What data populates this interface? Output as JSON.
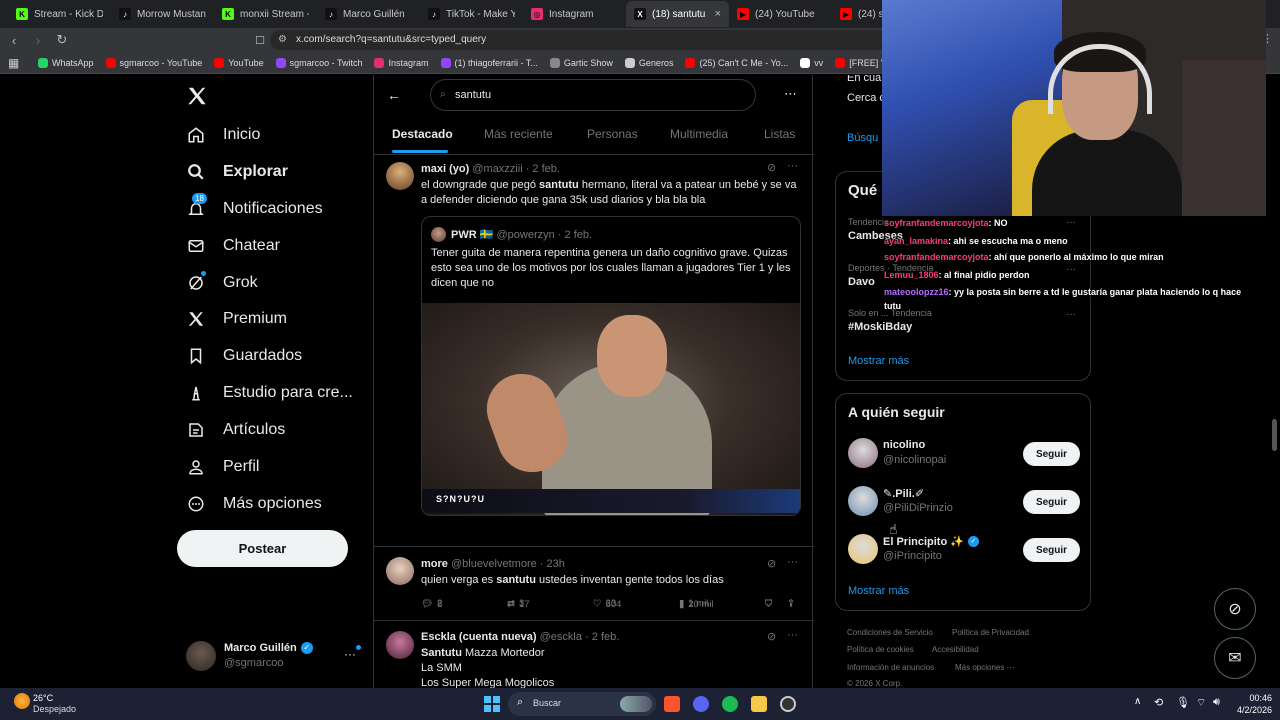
{
  "browser": {
    "tabs": [
      {
        "label": "Stream - Kick D",
        "color": "#53fc18",
        "glyph": "K"
      },
      {
        "label": "Morrow Mustangs",
        "color": "#ffffff",
        "glyph": "♪"
      },
      {
        "label": "monxii Stream - W",
        "color": "#53fc18",
        "glyph": "K"
      },
      {
        "label": "Marco Guillén",
        "color": "#ffffff",
        "glyph": "♪"
      },
      {
        "label": "TikTok - Make Your",
        "color": "#ffffff",
        "glyph": "♪"
      },
      {
        "label": "Instagram",
        "color": "#e1306c",
        "glyph": "◎"
      },
      {
        "label": "(18) santutu",
        "color": "#ffffff",
        "glyph": "X"
      },
      {
        "label": "(24) YouTube",
        "color": "#ff0000",
        "glyph": "▶"
      },
      {
        "label": "(24) sgm",
        "color": "#ff0000",
        "glyph": "▶"
      }
    ],
    "url": "x.com/search?q=santutu&src=typed_query",
    "bookmarks": [
      {
        "label": "WhatsApp",
        "color": "#25d366"
      },
      {
        "label": "sgmarcoo - YouTube",
        "color": "#ff0000"
      },
      {
        "label": "YouTube",
        "color": "#ff0000"
      },
      {
        "label": "sgmarcoo - Twitch",
        "color": "#9146ff"
      },
      {
        "label": "Instagram",
        "color": "#e1306c"
      },
      {
        "label": "(1) thiagoferrarii - T...",
        "color": "#9146ff"
      },
      {
        "label": "Gartic Show",
        "color": "#888888"
      },
      {
        "label": "Generos",
        "color": "#cccccc"
      },
      {
        "label": "(25) Can't C Me - Yo...",
        "color": "#ff0000"
      },
      {
        "label": "vv",
        "color": "#ffffff"
      },
      {
        "label": "[FREE] \"Direct\" - Ra...",
        "color": "#ff0000"
      }
    ]
  },
  "nav": {
    "items": [
      {
        "label": "Inicio",
        "icon": "home-icon"
      },
      {
        "label": "Explorar",
        "icon": "search-icon",
        "bold": true
      },
      {
        "label": "Notificaciones",
        "icon": "bell-icon",
        "badge": "18"
      },
      {
        "label": "Chatear",
        "icon": "mail-icon"
      },
      {
        "label": "Grok",
        "icon": "grok-icon"
      },
      {
        "label": "Premium",
        "icon": "x-logo-icon"
      },
      {
        "label": "Guardados",
        "icon": "bookmark-icon"
      },
      {
        "label": "Estudio para cre...",
        "icon": "studio-icon"
      },
      {
        "label": "Artículos",
        "icon": "article-icon"
      },
      {
        "label": "Perfil",
        "icon": "person-icon"
      },
      {
        "label": "Más opciones",
        "icon": "more-circle-icon"
      }
    ],
    "post_label": "Postear",
    "account": {
      "name": "Marco Guillén",
      "handle": "@sgmarcoo"
    }
  },
  "search": {
    "value": "santutu"
  },
  "tabs": [
    "Destacado",
    "Más reciente",
    "Personas",
    "Multimedia",
    "Listas"
  ],
  "tweets": [
    {
      "name": "maxi (yo)",
      "handle": "@maxzziii",
      "date": "· 2 feb.",
      "text_before": "el downgrade que pegó ",
      "text_bold": "santutu",
      "text_after": " hermano, literal va a patear un bebé y se va a defender diciendo que gana 35k usd diarios y bla bla bla",
      "quote": {
        "name": "PWR 🇸🇪",
        "handle": "@powerzyn",
        "date": "· 2 feb.",
        "text": "Tener guita de manera repentina genera un daño cognitivo grave. Quizas esto sea uno de los motivos por los cuales llaman a jugadores Tier 1 y les dicen que no",
        "video_brand": "S?N?U?U"
      },
      "replies": "8",
      "reposts": "17",
      "likes": "604",
      "views": "20 mil"
    },
    {
      "name": "more",
      "handle": "@bluevelvetmore",
      "date": "· 23h",
      "text_before": "quien verga es ",
      "text_bold": "santutu",
      "text_after": " ustedes inventan gente todos los días",
      "replies": "2",
      "reposts": "3",
      "likes": "33",
      "views": "1 mil"
    },
    {
      "name": "Esckla (cuenta nueva)",
      "handle": "@esckla",
      "date": "· 2 feb.",
      "line1_bold": "Santutu",
      "line1_after": " Mazza Mortedor",
      "line2": "La SMM",
      "line3": "Los Super Mega Mogolicos"
    }
  ],
  "right": {
    "partial_top": "En cua",
    "partial_near": "Cerca c",
    "partial_search": "Búsqu",
    "whats_happening": "Qué",
    "trends": [
      {
        "context": "Tendencia",
        "name": "Cambeses"
      },
      {
        "context": "Deportes · Tendencia",
        "name": "Davo"
      },
      {
        "context": "Solo en ... Tendencia",
        "name": "#MoskiBday"
      }
    ],
    "show_more": "Mostrar más",
    "who_to_follow": "A quién seguir",
    "follow": [
      {
        "name": "nicolino",
        "handle": "@nicolinopai",
        "verified": false,
        "color": "#8a6d7d"
      },
      {
        "name": "✎.Pili.✐",
        "handle": "@PiliDiPrinzio",
        "verified": false,
        "color": "#6f8fb0"
      },
      {
        "name": "El Principito ✨",
        "handle": "@iPrincipito",
        "verified": true,
        "color": "#e8c36a"
      }
    ],
    "follow_label": "Seguir",
    "show_more2": "Mostrar más",
    "footer": [
      "Condiciones de Servicio",
      "Política de Privacidad",
      "Política de cookies",
      "Accesibilidad",
      "Información de anuncios",
      "Más opciones ···",
      "© 2026 X Corp."
    ]
  },
  "chat": [
    {
      "user": "soyfranfandemarcoyjota",
      "color": "#ff3b7a",
      "msg": ": NO"
    },
    {
      "user": "ayan_lamakina",
      "color": "#ff3b7a",
      "msg": ": ahi se escucha ma o meno"
    },
    {
      "user": "soyfranfandemarcoyjota",
      "color": "#ff3b7a",
      "msg": ": ahí que ponerlo al máximo lo que miran"
    },
    {
      "user": "Lemuu_1806",
      "color": "#ff3b7a",
      "msg": ": al final pidio perdon"
    },
    {
      "user": "mateoolopzz16",
      "color": "#b06cff",
      "msg": ": yy la posta sin berre a td le gustaría ganar plata haciendo lo q hace"
    },
    {
      "user": "",
      "color": "#ffffff",
      "msg": "tutu"
    }
  ],
  "taskbar": {
    "weather_temp": "26°C",
    "weather_desc": "Despejado",
    "search_label": "Buscar",
    "time": "00:46",
    "date": "4/2/2026"
  }
}
